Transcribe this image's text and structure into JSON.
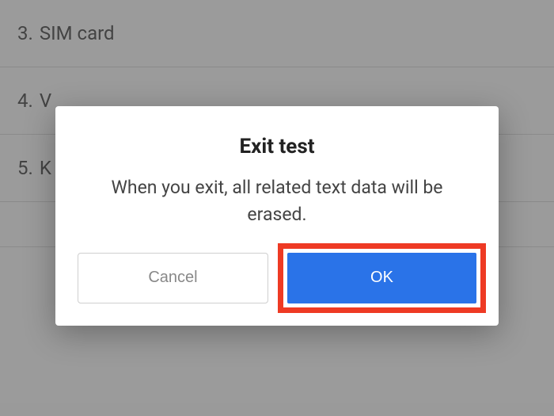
{
  "list": {
    "items": [
      {
        "number": "3.",
        "text": "SIM card"
      },
      {
        "number": "4.",
        "text": "V"
      },
      {
        "number": "5.",
        "text": "K"
      }
    ]
  },
  "dialog": {
    "title": "Exit test",
    "message": "When you exit, all related text data will be erased.",
    "cancel_label": "Cancel",
    "ok_label": "OK"
  },
  "colors": {
    "primary": "#2a73e8",
    "highlight": "#ee3a24"
  }
}
